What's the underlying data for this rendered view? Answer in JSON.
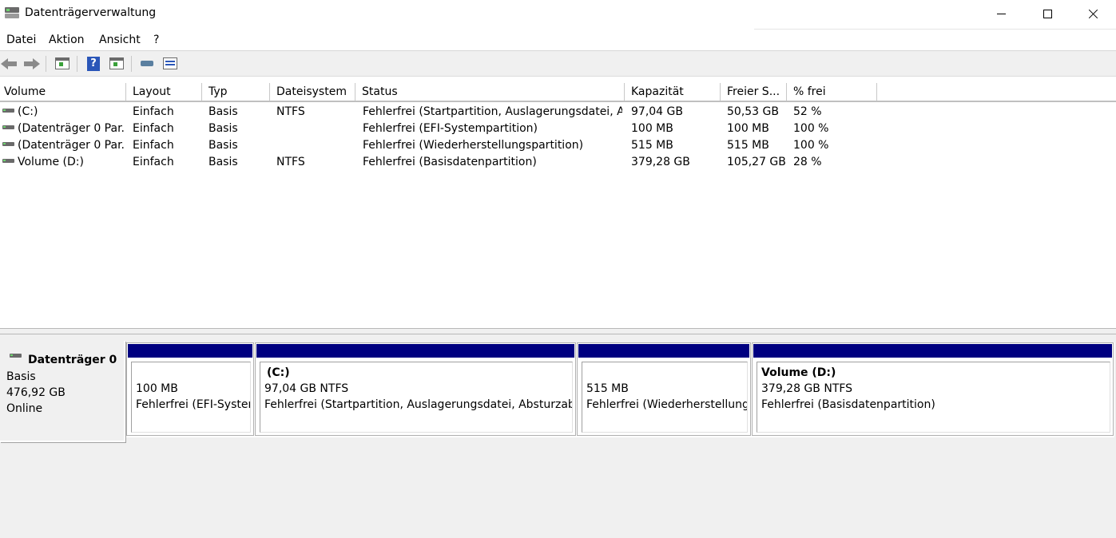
{
  "window": {
    "title": "Datenträgerverwaltung"
  },
  "menu": [
    "Datei",
    "Aktion",
    "Ansicht",
    "?"
  ],
  "toolbar": {
    "icons": [
      "back-arrow-icon",
      "forward-arrow-icon",
      "console-tree-icon",
      "help-icon",
      "properties-icon",
      "key-icon",
      "list-icon"
    ]
  },
  "volume_table": {
    "headers": [
      "Volume",
      "Layout",
      "Typ",
      "Dateisystem",
      "Status",
      "Kapazität",
      "Freier S...",
      "% frei"
    ],
    "rows": [
      {
        "volume": " (C:)",
        "layout": "Einfach",
        "typ": "Basis",
        "dateisystem": "NTFS",
        "status": "Fehlerfrei (Startpartition, Auslagerungsdatei, A...",
        "kapazitaet": "97,04 GB",
        "frei": "50,53 GB",
        "prozent": "52 %"
      },
      {
        "volume": "(Datenträger 0 Par...",
        "layout": "Einfach",
        "typ": "Basis",
        "dateisystem": "",
        "status": "Fehlerfrei (EFI-Systempartition)",
        "kapazitaet": "100 MB",
        "frei": "100 MB",
        "prozent": "100 %"
      },
      {
        "volume": "(Datenträger 0 Par...",
        "layout": "Einfach",
        "typ": "Basis",
        "dateisystem": "",
        "status": "Fehlerfrei (Wiederherstellungspartition)",
        "kapazitaet": "515 MB",
        "frei": "515 MB",
        "prozent": "100 %"
      },
      {
        "volume": "Volume (D:)",
        "layout": "Einfach",
        "typ": "Basis",
        "dateisystem": "NTFS",
        "status": "Fehlerfrei (Basisdatenpartition)",
        "kapazitaet": "379,28 GB",
        "frei": "105,27 GB",
        "prozent": "28 %"
      }
    ]
  },
  "disk": {
    "name": "Datenträger 0",
    "type": "Basis",
    "size": "476,92 GB",
    "state": "Online",
    "partitions": [
      {
        "label": "",
        "size": "100 MB",
        "status": "Fehlerfrei (EFI-Systempartition)"
      },
      {
        "label": "(C:)",
        "size": "97,04 GB NTFS",
        "status": "Fehlerfrei (Startpartition, Auslagerungsdatei, Absturzabbild, Primäre Partition)"
      },
      {
        "label": "",
        "size": "515 MB",
        "status": "Fehlerfrei (Wiederherstellungspartition)"
      },
      {
        "label": "Volume  (D:)",
        "size": "379,28 GB NTFS",
        "status": "Fehlerfrei (Basisdatenpartition)"
      }
    ]
  },
  "colors": {
    "partition_header": "#000080",
    "background": "#f0f0f0"
  }
}
